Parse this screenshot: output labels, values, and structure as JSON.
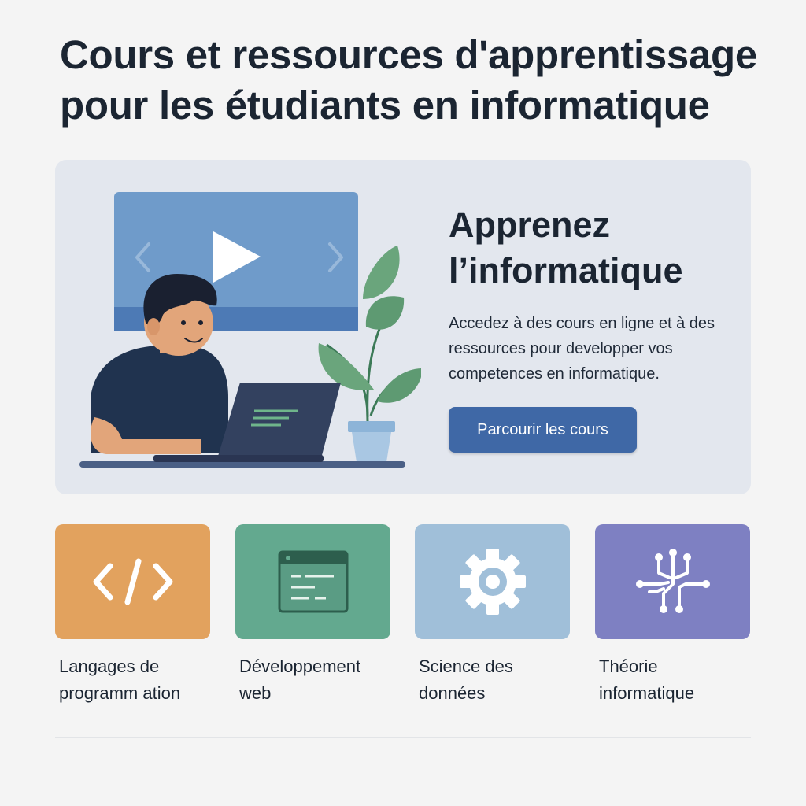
{
  "page": {
    "title": "Cours et ressources d'apprentissage pour les étudiants en informatique"
  },
  "hero": {
    "title": "Apprenez l’informatique",
    "description": "Accedez à des cours en ligne et à des ressources pour developper vos competences en informatique.",
    "cta_label": "Parcourir les cours",
    "illustration": "student-with-laptop-and-video-player",
    "background_color": "#e3e7ee",
    "cta_color": "#3f68a6"
  },
  "categories": [
    {
      "label": "Langages de\nprogramm ation",
      "icon": "code-icon",
      "color": "#e2a25e"
    },
    {
      "label": "Développement\nweb",
      "icon": "browser-window-icon",
      "color": "#63a98f"
    },
    {
      "label": "Science des\ndonnées",
      "icon": "gear-icon",
      "color": "#a0bfd9"
    },
    {
      "label": "Théorie\ninformatique",
      "icon": "circuit-icon",
      "color": "#7e80c2"
    }
  ]
}
